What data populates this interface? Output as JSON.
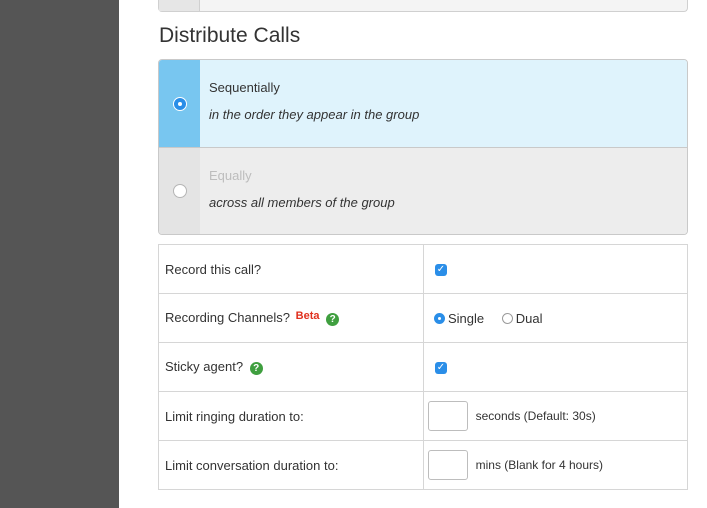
{
  "section": {
    "title": "Distribute Calls"
  },
  "distribute": {
    "options": [
      {
        "title": "Sequentially",
        "subtitle": "in the order they appear in the group",
        "selected": true
      },
      {
        "title": "Equally",
        "subtitle": "across all members of the group",
        "selected": false
      }
    ]
  },
  "settings": {
    "record": {
      "label": "Record this call?",
      "checked": true
    },
    "recording_channels": {
      "label": "Recording Channels?",
      "badge": "Beta",
      "options": [
        "Single",
        "Dual"
      ],
      "selected": "Single"
    },
    "sticky_agent": {
      "label": "Sticky agent?",
      "checked": true
    },
    "ring_limit": {
      "label": "Limit ringing duration to:",
      "value": "",
      "hint": "seconds (Default: 30s)"
    },
    "conv_limit": {
      "label": "Limit conversation duration to:",
      "value": "",
      "hint": "mins (Blank for 4 hours)"
    }
  },
  "colors": {
    "accent": "#2a8ee8",
    "selected_bg": "#dff3fc",
    "selected_strip": "#78c6f0",
    "beta": "#e0301e",
    "help": "#3f9f3f",
    "sidebar": "#555555"
  }
}
